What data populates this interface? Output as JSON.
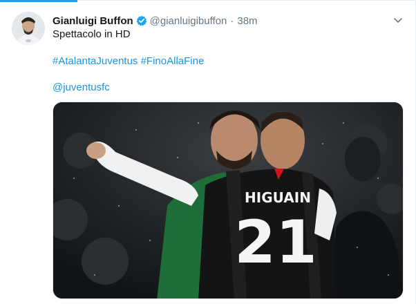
{
  "tweet": {
    "author_name": "Gianluigi Buffon",
    "author_handle": "@gianluigibuffon",
    "separator": "·",
    "timestamp": "38m",
    "verified": true,
    "text": "Spettacolo in HD",
    "hashtags": [
      "#AtalantaJuventus",
      "#FinoAllaFine"
    ],
    "mention": "@juventusfc",
    "media": {
      "jersey_name": "HIGUAIN",
      "jersey_number": "21"
    }
  },
  "colors": {
    "accent": "#1da1f2",
    "link": "#1b95e0",
    "secondary_text": "#657786"
  },
  "icons": {
    "verified": "verified-badge-icon",
    "menu": "chevron-down-icon"
  }
}
